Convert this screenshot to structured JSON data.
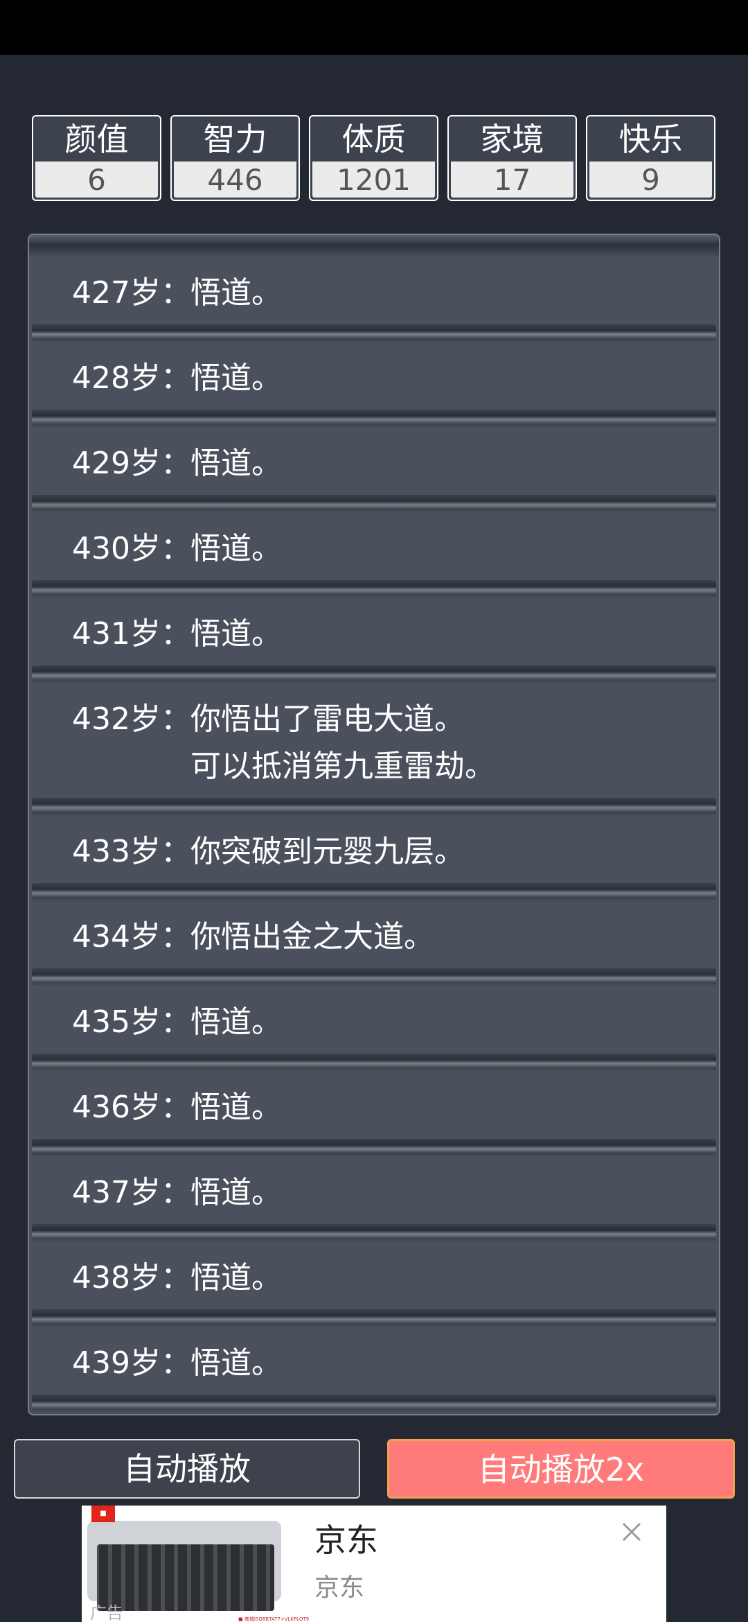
{
  "stats": [
    {
      "label": "颜值",
      "value": "6"
    },
    {
      "label": "智力",
      "value": "446"
    },
    {
      "label": "体质",
      "value": "1201"
    },
    {
      "label": "家境",
      "value": "17"
    },
    {
      "label": "快乐",
      "value": "9"
    }
  ],
  "log": [
    {
      "age": "427岁：",
      "event": "悟道。"
    },
    {
      "age": "428岁：",
      "event": "悟道。"
    },
    {
      "age": "429岁：",
      "event": "悟道。"
    },
    {
      "age": "430岁：",
      "event": "悟道。"
    },
    {
      "age": "431岁：",
      "event": "悟道。"
    },
    {
      "age": "432岁：",
      "event": "你悟出了雷电大道。\n可以抵消第九重雷劫。"
    },
    {
      "age": "433岁：",
      "event": "你突破到元婴九层。"
    },
    {
      "age": "434岁：",
      "event": "你悟出金之大道。"
    },
    {
      "age": "435岁：",
      "event": "悟道。"
    },
    {
      "age": "436岁：",
      "event": "悟道。"
    },
    {
      "age": "437岁：",
      "event": "悟道。"
    },
    {
      "age": "438岁：",
      "event": "悟道。"
    },
    {
      "age": "439岁：",
      "event": "悟道。"
    }
  ],
  "buttons": {
    "auto_play": "自动播放",
    "auto_play_2x": "自动播放2x"
  },
  "ad": {
    "title": "京东",
    "subtitle": "京东",
    "tag": "广告",
    "footer": "■ 商城ISO8BTAT7+VLKPLOT9",
    "image": "keyboard-product-image",
    "close_icon": "close-icon"
  },
  "colors": {
    "background": "#232833",
    "panel": "#4a515c",
    "primary_button": "#ff7b7b",
    "primary_button_border": "#f0a24a"
  }
}
